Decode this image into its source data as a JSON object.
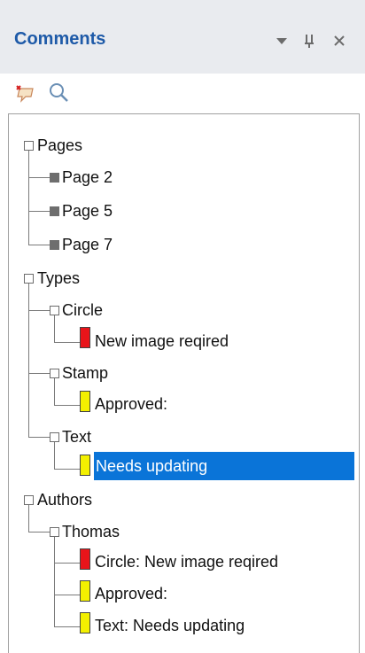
{
  "panel": {
    "title": "Comments",
    "header_icons": [
      "dropdown-arrow-icon",
      "pin-icon",
      "close-icon"
    ]
  },
  "toolbar": {
    "buttons": [
      "comment-flag-icon",
      "search-icon"
    ]
  },
  "tree": {
    "pages": {
      "label": "Pages",
      "items": [
        "Page 2",
        "Page 5",
        "Page 7"
      ]
    },
    "types": {
      "label": "Types",
      "circle": {
        "label": "Circle",
        "child": "New image reqired"
      },
      "stamp": {
        "label": "Stamp",
        "child": "Approved:"
      },
      "text": {
        "label": "Text",
        "child": "Needs updating"
      }
    },
    "authors": {
      "label": "Authors",
      "thomas": {
        "label": "Thomas",
        "children": [
          "Circle: New image reqired",
          "Approved:",
          "Text: Needs updating"
        ]
      }
    }
  },
  "colors": {
    "title": "#1e5aa8",
    "selection": "#0a74d8",
    "circle_swatch": "#e8141a",
    "note_swatch": "#f3f000"
  }
}
